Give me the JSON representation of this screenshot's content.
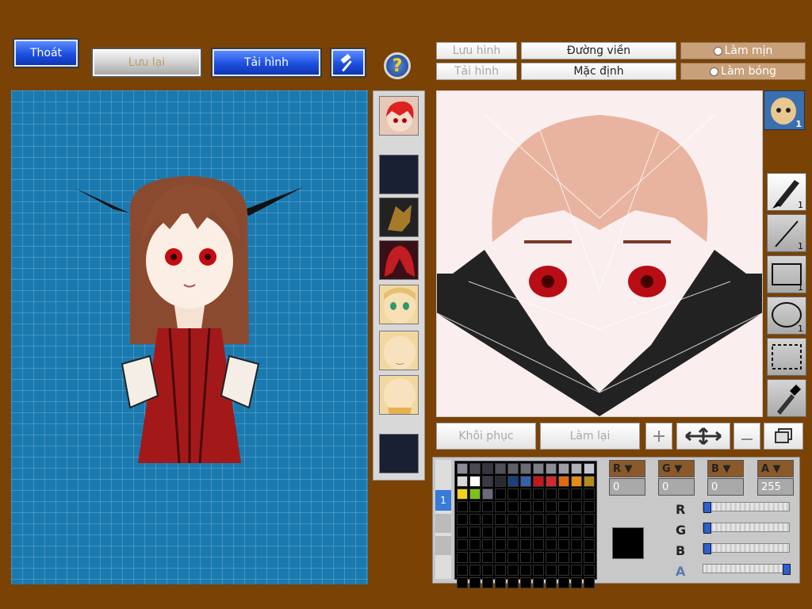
{
  "toolbar_left": {
    "exit_label": "Thoát",
    "save_label": "Lưu lại",
    "load_label": "Tải hình",
    "hammer_icon": "hammer-icon",
    "help_label": "?"
  },
  "toolbar_right": {
    "save_image_label": "Lưu hình",
    "load_image_label": "Tải hình",
    "outline_label": "Đường viền",
    "default_label": "Mặc định",
    "smooth_label": "Làm mịn",
    "shine_label": "Làm bóng"
  },
  "layer_badge": "1",
  "tools": [
    {
      "name": "brush-tool",
      "icon": "brush-icon",
      "count": "1"
    },
    {
      "name": "line-tool",
      "icon": "line-icon",
      "count": "1"
    },
    {
      "name": "rectangle-tool",
      "icon": "rectangle-icon",
      "count": "1"
    },
    {
      "name": "ellipse-tool",
      "icon": "ellipse-icon",
      "count": "1"
    },
    {
      "name": "select-tool",
      "icon": "dashed-select-icon",
      "count": ""
    },
    {
      "name": "eyedropper-tool",
      "icon": "eyedropper-icon",
      "count": ""
    }
  ],
  "bottom_actions": {
    "restore_label": "Khôi phục",
    "redo_label": "Làm lại"
  },
  "palette_tab": "1",
  "palette_colors": [
    "#8b8b9b",
    "#4a4a55",
    "#353540",
    "#4f4f57",
    "#5f5f68",
    "#6b6b74",
    "#7d7d86",
    "#8d8d96",
    "#9d9da6",
    "#b0b0b8",
    "#c5c5cc",
    "#d8d8d8",
    "#ffffff",
    "#3a3a44",
    "#2a2a33",
    "#1d3f7a",
    "#3a5faa",
    "#c4161c",
    "#d42a2a",
    "#e06a10",
    "#e88a18",
    "#b88a1a",
    "#f2d21c",
    "#7ac21a",
    "#6a6a7a"
  ],
  "channels": {
    "r": {
      "label": "R",
      "value": "0",
      "fraction": 0.0
    },
    "g": {
      "label": "G",
      "value": "0",
      "fraction": 0.0
    },
    "b": {
      "label": "B",
      "value": "0",
      "fraction": 0.0
    },
    "a": {
      "label": "A",
      "value": "255",
      "fraction": 1.0
    }
  },
  "current_color": "#000000",
  "theme": {
    "background": "#7a4204",
    "preview_bg": "#1a7ab0",
    "accent_blue": "#1d4fe0"
  }
}
